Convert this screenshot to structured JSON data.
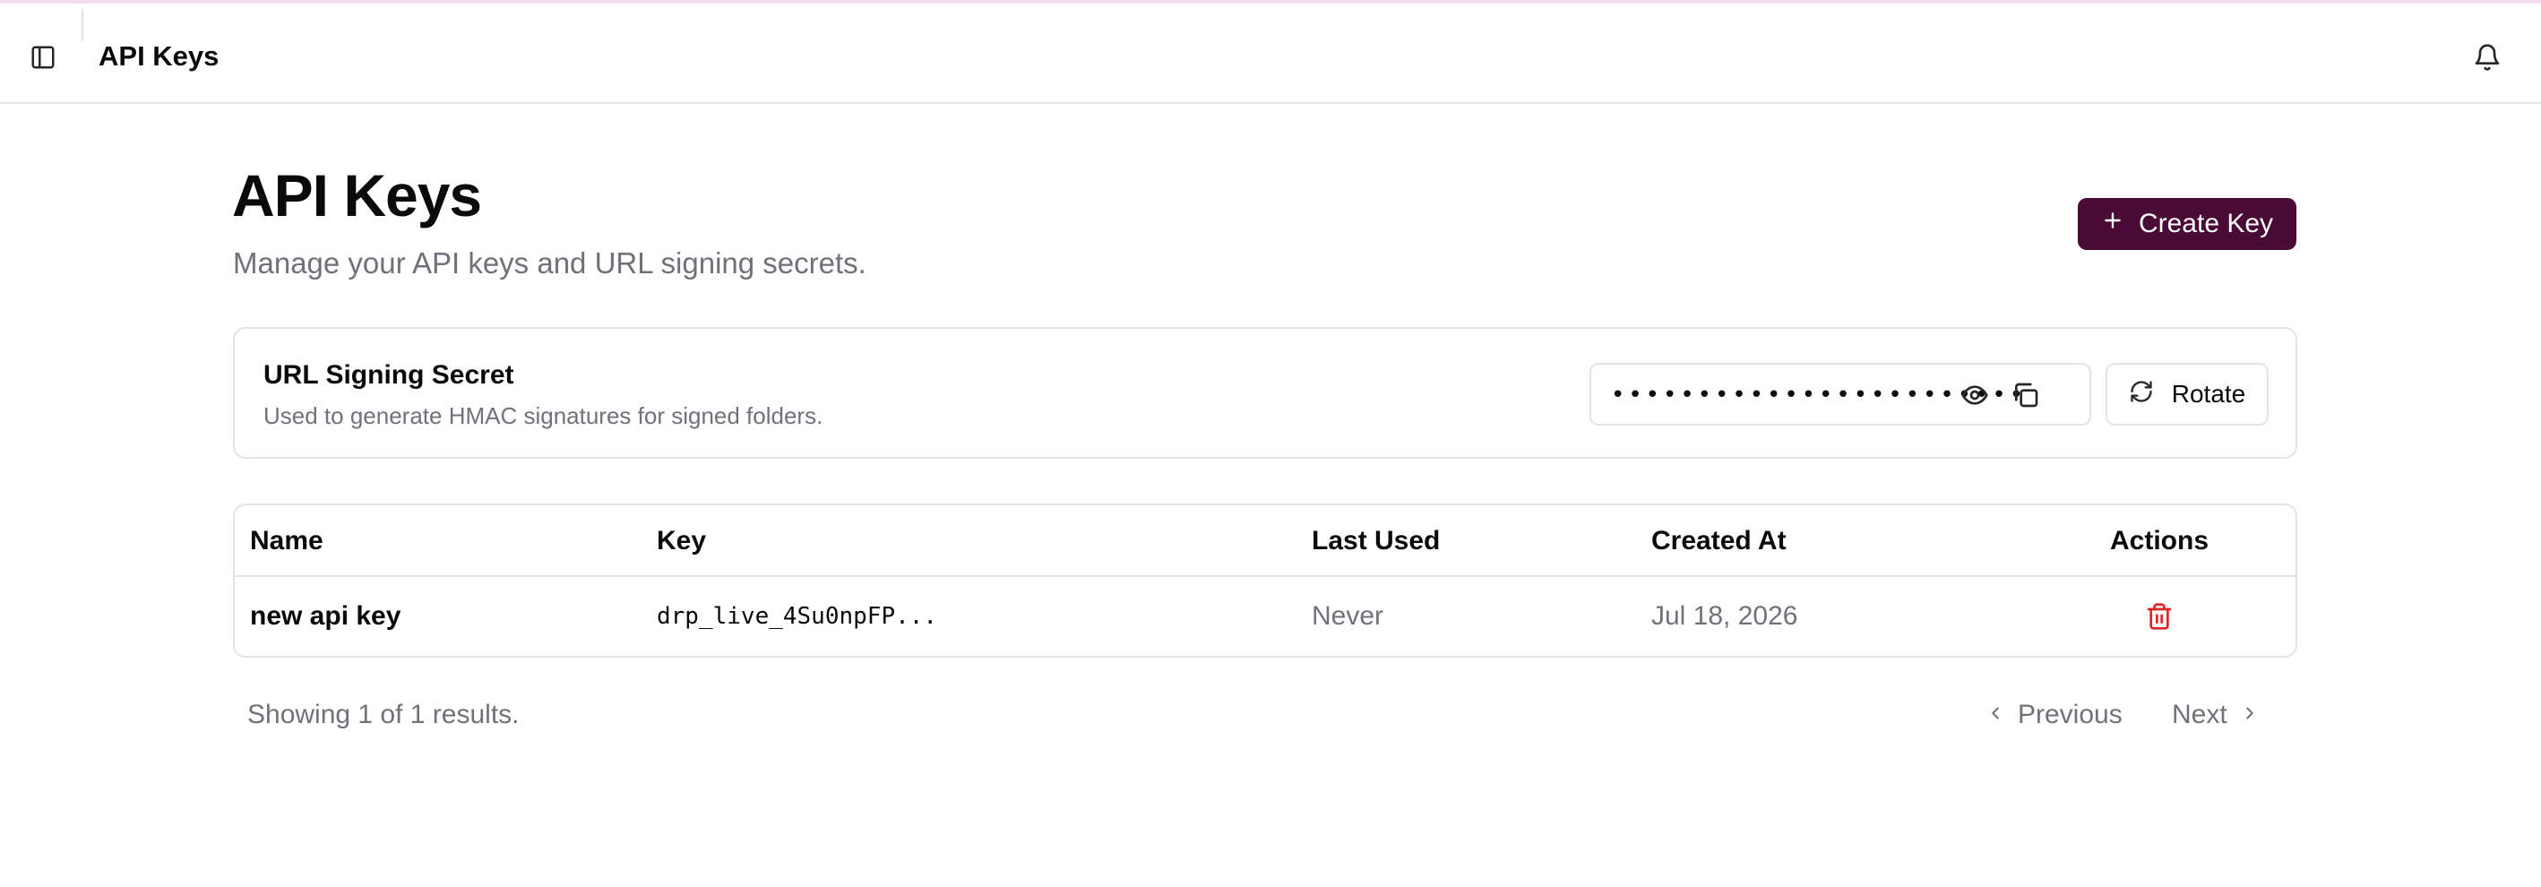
{
  "header": {
    "title": "API Keys",
    "sidebar_toggle_icon": "sidebar-panel-icon",
    "notification_icon": "bell-icon"
  },
  "page": {
    "title": "API Keys",
    "subtitle": "Manage your API keys and URL signing secrets.",
    "create_button": {
      "label": "Create Key",
      "icon": "plus-icon",
      "color": "#4a0a36"
    }
  },
  "signing_secret": {
    "title": "URL Signing Secret",
    "description": "Used to generate HMAC signatures for signed folders.",
    "masked_value": "••••••••••••••••••••••••",
    "reveal_icon": "eye-icon",
    "copy_icon": "copy-icon",
    "rotate_button": {
      "label": "Rotate",
      "icon": "refresh-icon"
    }
  },
  "table": {
    "columns": [
      "Name",
      "Key",
      "Last Used",
      "Created At",
      "Actions"
    ],
    "rows": [
      {
        "name": "new api key",
        "key": "drp_live_4Su0npFP...",
        "last_used": "Never",
        "created_at": "Jul 18, 2026",
        "action_icon": "trash-icon"
      }
    ]
  },
  "pagination": {
    "summary": "Showing 1 of 1 results.",
    "previous_label": "Previous",
    "next_label": "Next"
  },
  "colors": {
    "accent": "#4a0a36",
    "danger": "#dc2626",
    "muted": "#71717a",
    "border": "#e4e4e7"
  }
}
